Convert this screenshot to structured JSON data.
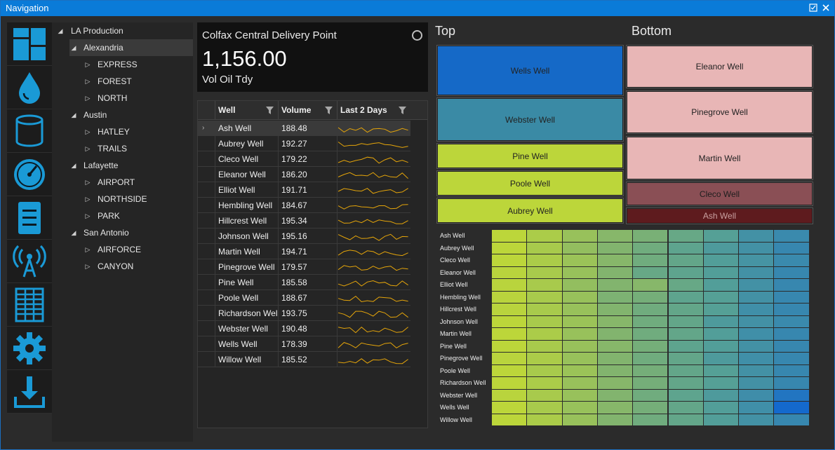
{
  "window": {
    "title": "Navigation"
  },
  "rail": {
    "icons": [
      "dashboard-icon",
      "oil-drop-icon",
      "tank-icon",
      "gauge-icon",
      "report-icon",
      "signal-tower-icon",
      "table-icon",
      "gear-icon",
      "download-icon"
    ],
    "accent": "#1a9ad6"
  },
  "tree": {
    "root": "LA Production",
    "nodes": [
      {
        "label": "Alexandria",
        "level": 1,
        "expanded": true,
        "selected": true
      },
      {
        "label": "EXPRESS",
        "level": 2,
        "expanded": false
      },
      {
        "label": "FOREST",
        "level": 2,
        "expanded": false
      },
      {
        "label": "NORTH",
        "level": 2,
        "expanded": false
      },
      {
        "label": "Austin",
        "level": 1,
        "expanded": true
      },
      {
        "label": "HATLEY",
        "level": 2,
        "expanded": false
      },
      {
        "label": "TRAILS",
        "level": 2,
        "expanded": false
      },
      {
        "label": "Lafayette",
        "level": 1,
        "expanded": true
      },
      {
        "label": "AIRPORT",
        "level": 2,
        "expanded": false
      },
      {
        "label": "NORTHSIDE",
        "level": 2,
        "expanded": false
      },
      {
        "label": "PARK",
        "level": 2,
        "expanded": false
      },
      {
        "label": "San Antonio",
        "level": 1,
        "expanded": true
      },
      {
        "label": "AIRFORCE",
        "level": 2,
        "expanded": false
      },
      {
        "label": "CANYON",
        "level": 2,
        "expanded": false
      }
    ]
  },
  "kpi": {
    "title": "Colfax Central Delivery Point",
    "value": "1,156.00",
    "subtitle": "Vol Oil Tdy"
  },
  "grid": {
    "columns": [
      "Well",
      "Volume",
      "Last 2 Days"
    ],
    "sparkline_color": "#e5a50a",
    "rows": [
      {
        "well": "Ash Well",
        "volume": "188.48",
        "selected": true
      },
      {
        "well": "Aubrey Well",
        "volume": "192.27"
      },
      {
        "well": "Cleco Well",
        "volume": "179.22"
      },
      {
        "well": "Eleanor Well",
        "volume": "186.20"
      },
      {
        "well": "Elliot Well",
        "volume": "191.71"
      },
      {
        "well": "Hembling Well",
        "volume": "184.67"
      },
      {
        "well": "Hillcrest Well",
        "volume": "195.34"
      },
      {
        "well": "Johnson Well",
        "volume": "195.16"
      },
      {
        "well": "Martin Well",
        "volume": "194.71"
      },
      {
        "well": "Pinegrove Well",
        "volume": "179.57"
      },
      {
        "well": "Pine Well",
        "volume": "185.58"
      },
      {
        "well": "Poole Well",
        "volume": "188.67"
      },
      {
        "well": "Richardson Well",
        "volume": "193.75"
      },
      {
        "well": "Webster Well",
        "volume": "190.48"
      },
      {
        "well": "Wells Well",
        "volume": "178.39"
      },
      {
        "well": "Willow Well",
        "volume": "185.52"
      }
    ]
  },
  "top": {
    "title": "Top",
    "items": [
      {
        "label": "Wells Well",
        "color": "#1569c7"
      },
      {
        "label": "Webster Well",
        "color": "#3a8aa5"
      },
      {
        "label": "Pine Well",
        "color": "#bcd63a"
      },
      {
        "label": "Poole Well",
        "color": "#bcd63a"
      },
      {
        "label": "Aubrey Well",
        "color": "#bcd63a"
      }
    ]
  },
  "bottom": {
    "title": "Bottom",
    "items": [
      {
        "label": "Eleanor Well",
        "color": "#e8b6b6"
      },
      {
        "label": "Pinegrove Well",
        "color": "#e8b6b6"
      },
      {
        "label": "Martin Well",
        "color": "#e8b6b6"
      },
      {
        "label": "Cleco Well",
        "color": "#8a4f55"
      },
      {
        "label": "Ash Well",
        "color": "#5e1b1e"
      }
    ]
  },
  "heatmap": {
    "rows": [
      "Ash Well",
      "Aubrey Well",
      "Cleco Well",
      "Eleanor Well",
      "Elliot Well",
      "Hembling Well",
      "Hillcrest Well",
      "Johnson Well",
      "Martin Well",
      "Pine Well",
      "Pinegrove Well",
      "Poole Well",
      "Richardson Well",
      "Webster Well",
      "Wells Well",
      "Willow Well"
    ],
    "columns": 9,
    "levels": [
      [
        0.0,
        0.1,
        0.22,
        0.32,
        0.4,
        0.5,
        0.6,
        0.72,
        0.78
      ],
      [
        0.0,
        0.12,
        0.25,
        0.35,
        0.45,
        0.55,
        0.65,
        0.72,
        0.8
      ],
      [
        0.0,
        0.1,
        0.2,
        0.32,
        0.45,
        0.52,
        0.62,
        0.7,
        0.78
      ],
      [
        0.02,
        0.12,
        0.22,
        0.35,
        0.5,
        0.55,
        0.62,
        0.72,
        0.8
      ],
      [
        0.02,
        0.12,
        0.25,
        0.35,
        0.32,
        0.5,
        0.62,
        0.72,
        0.8
      ],
      [
        0.02,
        0.12,
        0.22,
        0.38,
        0.42,
        0.55,
        0.6,
        0.72,
        0.8
      ],
      [
        0.02,
        0.12,
        0.22,
        0.35,
        0.45,
        0.52,
        0.6,
        0.74,
        0.8
      ],
      [
        0.0,
        0.12,
        0.2,
        0.32,
        0.45,
        0.52,
        0.65,
        0.72,
        0.78
      ],
      [
        0.0,
        0.1,
        0.22,
        0.35,
        0.45,
        0.52,
        0.62,
        0.74,
        0.8
      ],
      [
        0.0,
        0.12,
        0.22,
        0.32,
        0.42,
        0.55,
        0.62,
        0.72,
        0.8
      ],
      [
        0.02,
        0.1,
        0.22,
        0.35,
        0.45,
        0.52,
        0.65,
        0.74,
        0.8
      ],
      [
        0.0,
        0.12,
        0.2,
        0.35,
        0.42,
        0.52,
        0.6,
        0.72,
        0.8
      ],
      [
        0.0,
        0.1,
        0.22,
        0.32,
        0.42,
        0.52,
        0.6,
        0.72,
        0.8
      ],
      [
        0.02,
        0.12,
        0.22,
        0.35,
        0.45,
        0.55,
        0.65,
        0.75,
        0.92
      ],
      [
        0.0,
        0.12,
        0.22,
        0.32,
        0.42,
        0.52,
        0.62,
        0.74,
        1.0
      ],
      [
        0.0,
        0.1,
        0.22,
        0.35,
        0.45,
        0.52,
        0.62,
        0.72,
        0.8
      ]
    ]
  }
}
